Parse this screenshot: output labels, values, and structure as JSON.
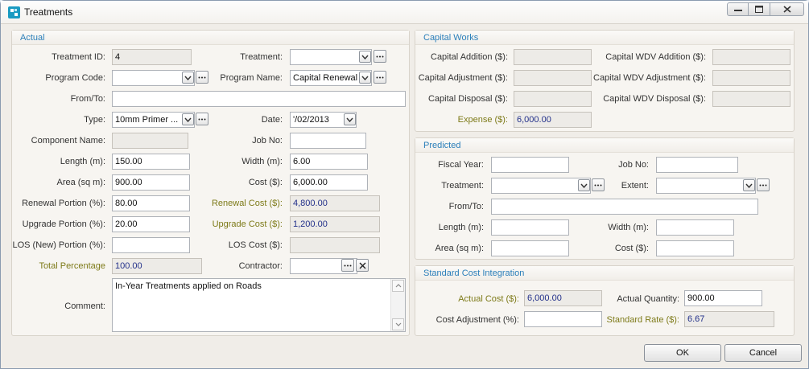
{
  "window": {
    "title": "Treatments"
  },
  "actual": {
    "header": "Actual",
    "treatment_id": {
      "label": "Treatment ID:",
      "value": "4"
    },
    "treatment": {
      "label": "Treatment:",
      "value": ""
    },
    "program_code": {
      "label": "Program Code:",
      "value": ""
    },
    "program_name": {
      "label": "Program Name:",
      "value": "Capital Renewal"
    },
    "from_to": {
      "label": "From/To:",
      "value": ""
    },
    "type": {
      "label": "Type:",
      "value": "10mm Primer ..."
    },
    "date": {
      "label": "Date:",
      "value": "'/02/2013"
    },
    "component_name": {
      "label": "Component Name:",
      "value": ""
    },
    "job_no": {
      "label": "Job No:",
      "value": ""
    },
    "length": {
      "label": "Length (m):",
      "value": "150.00"
    },
    "width": {
      "label": "Width (m):",
      "value": "6.00"
    },
    "area": {
      "label": "Area (sq m):",
      "value": "900.00"
    },
    "cost": {
      "label": "Cost ($):",
      "value": "6,000.00"
    },
    "renewal_portion": {
      "label": "Renewal Portion (%):",
      "value": "80.00"
    },
    "renewal_cost": {
      "label": "Renewal Cost ($):",
      "value": "4,800.00"
    },
    "upgrade_portion": {
      "label": "Upgrade Portion (%):",
      "value": "20.00"
    },
    "upgrade_cost": {
      "label": "Upgrade Cost ($):",
      "value": "1,200.00"
    },
    "los_portion": {
      "label": "LOS (New) Portion (%):",
      "value": ""
    },
    "los_cost": {
      "label": "LOS Cost ($):",
      "value": ""
    },
    "total_percentage": {
      "label": "Total Percentage",
      "value": "100.00"
    },
    "contractor": {
      "label": "Contractor:",
      "value": ""
    },
    "comment": {
      "label": "Comment:",
      "value": "In-Year Treatments applied on Roads"
    }
  },
  "capital": {
    "header": "Capital Works",
    "addition": {
      "label": "Capital Addition ($):",
      "value": ""
    },
    "wdv_addition": {
      "label": "Capital WDV Addition ($):",
      "value": ""
    },
    "adjustment": {
      "label": "Capital Adjustment ($):",
      "value": ""
    },
    "wdv_adjustment": {
      "label": "Capital WDV Adjustment ($):",
      "value": ""
    },
    "disposal": {
      "label": "Capital Disposal ($):",
      "value": ""
    },
    "wdv_disposal": {
      "label": "Capital WDV Disposal ($):",
      "value": ""
    },
    "expense": {
      "label": "Expense ($):",
      "value": "6,000.00"
    }
  },
  "predicted": {
    "header": "Predicted",
    "fiscal_year": {
      "label": "Fiscal Year:",
      "value": ""
    },
    "job_no": {
      "label": "Job No:",
      "value": ""
    },
    "treatment": {
      "label": "Treatment:",
      "value": ""
    },
    "extent": {
      "label": "Extent:",
      "value": ""
    },
    "from_to": {
      "label": "From/To:",
      "value": ""
    },
    "length": {
      "label": "Length (m):",
      "value": ""
    },
    "width": {
      "label": "Width (m):",
      "value": ""
    },
    "area": {
      "label": "Area (sq m):",
      "value": ""
    },
    "cost": {
      "label": "Cost ($):",
      "value": ""
    }
  },
  "standard": {
    "header": "Standard Cost Integration",
    "actual_cost": {
      "label": "Actual Cost ($):",
      "value": "6,000.00"
    },
    "actual_quantity": {
      "label": "Actual Quantity:",
      "value": "900.00"
    },
    "cost_adjustment": {
      "label": "Cost Adjustment (%):",
      "value": ""
    },
    "standard_rate": {
      "label": "Standard Rate ($):",
      "value": "6.67"
    }
  },
  "buttons": {
    "ok": "OK",
    "cancel": "Cancel"
  }
}
